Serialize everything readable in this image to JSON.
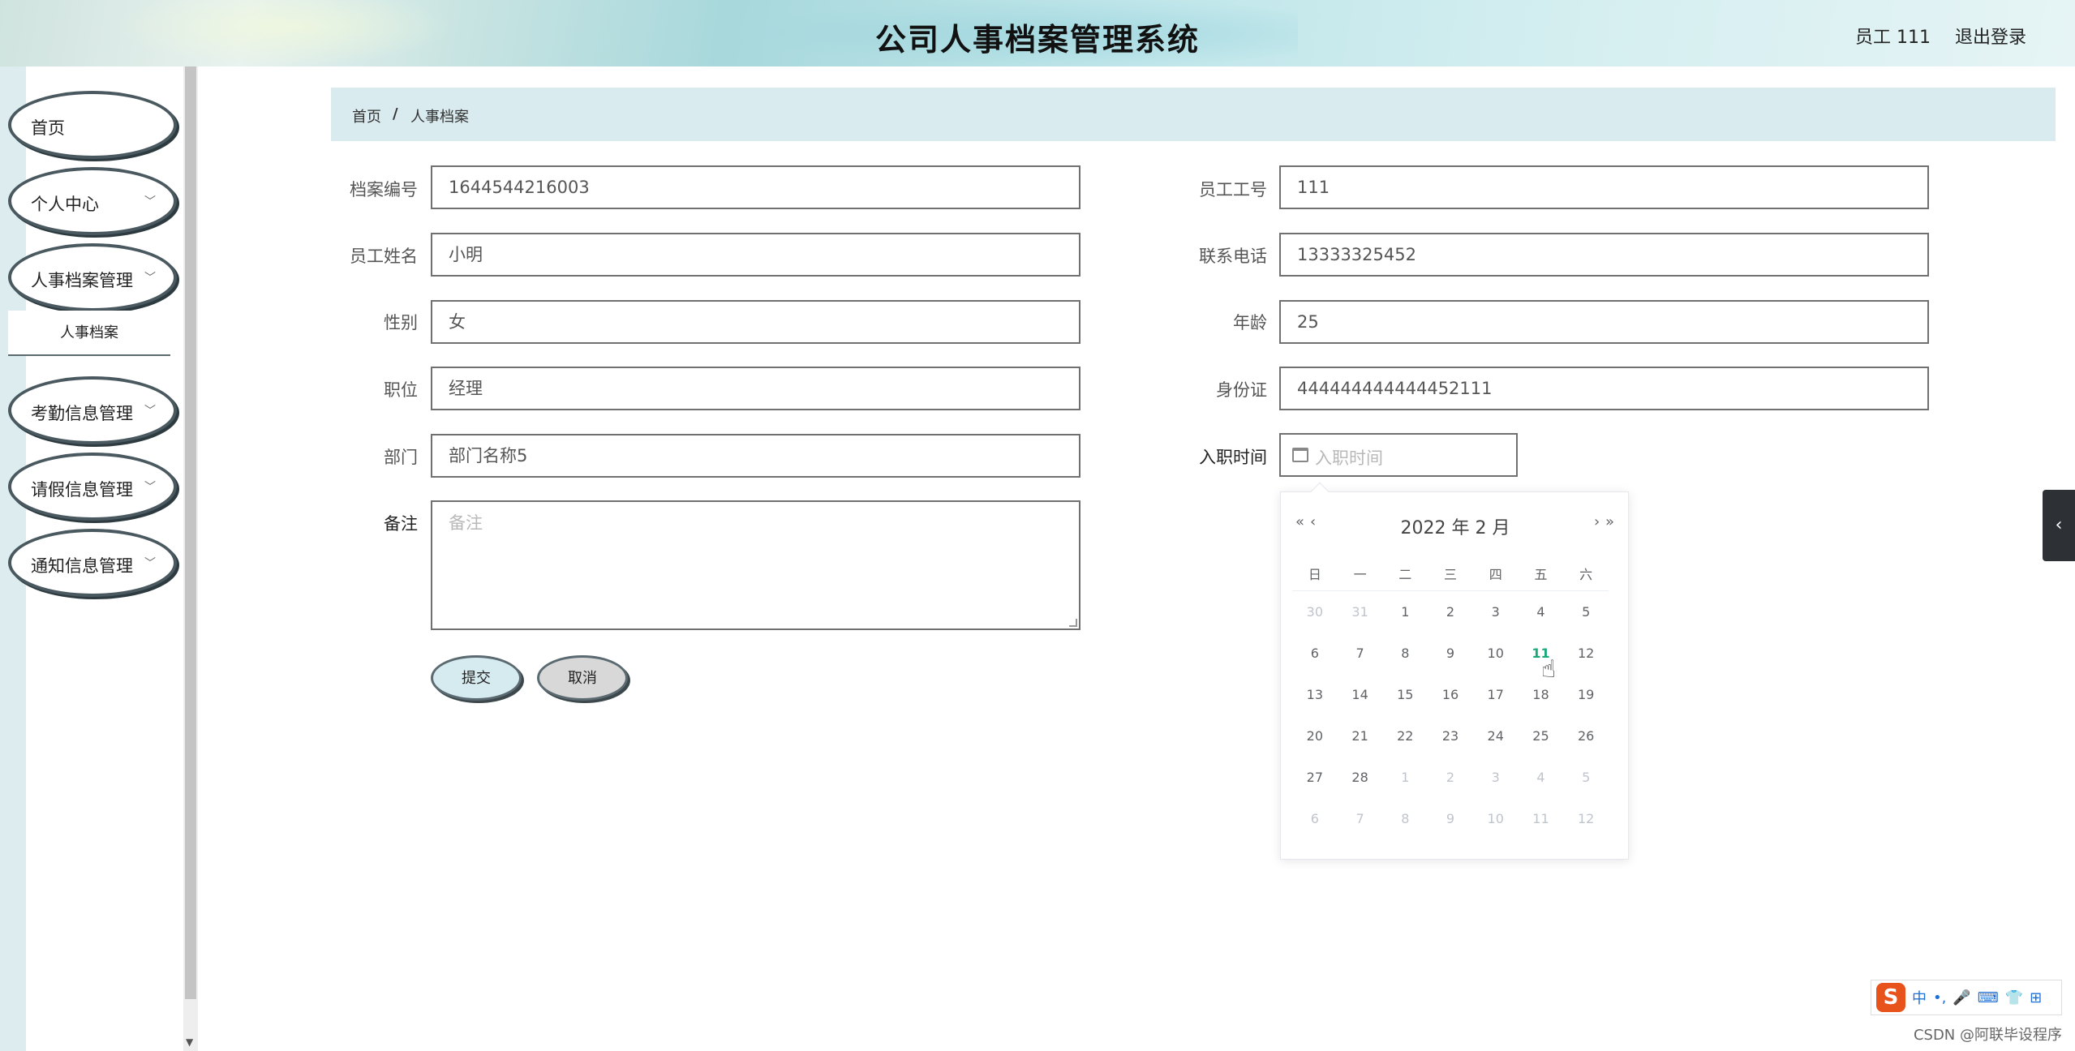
{
  "header": {
    "title": "公司人事档案管理系统",
    "user": "员工 111",
    "logout": "退出登录"
  },
  "sidebar": {
    "items": [
      {
        "label": "首页"
      },
      {
        "label": "个人中心"
      },
      {
        "label": "人事档案管理"
      },
      {
        "label": "考勤信息管理"
      },
      {
        "label": "请假信息管理"
      },
      {
        "label": "通知信息管理"
      }
    ],
    "submenu": {
      "label": "人事档案"
    },
    "chevron": "chevron-down-icon"
  },
  "breadcrumb": {
    "home": "首页",
    "separator": "/",
    "current": "人事档案"
  },
  "form": {
    "archive_no": {
      "label": "档案编号",
      "value": "1644544216003"
    },
    "employee_id": {
      "label": "员工工号",
      "value": "111"
    },
    "employee_name": {
      "label": "员工姓名",
      "value": "小明"
    },
    "phone": {
      "label": "联系电话",
      "value": "13333325452"
    },
    "gender": {
      "label": "性别",
      "value": "女"
    },
    "age": {
      "label": "年龄",
      "value": "25"
    },
    "position": {
      "label": "职位",
      "value": "经理"
    },
    "id_card": {
      "label": "身份证",
      "value": "444444444444452111"
    },
    "department": {
      "label": "部门",
      "value": "部门名称5"
    },
    "hire_date": {
      "label": "入职时间",
      "placeholder": "入职时间"
    },
    "remark": {
      "label": "备注",
      "placeholder": "备注"
    },
    "submit": "提交",
    "cancel": "取消"
  },
  "datepicker": {
    "prev_year": "«",
    "prev_month": "‹",
    "next_month": "›",
    "next_year": "»",
    "year_month": "2022 年  2 月",
    "weekdays": [
      "日",
      "一",
      "二",
      "三",
      "四",
      "五",
      "六"
    ],
    "rows": [
      [
        {
          "d": "30",
          "o": true
        },
        {
          "d": "31",
          "o": true
        },
        {
          "d": "1"
        },
        {
          "d": "2"
        },
        {
          "d": "3"
        },
        {
          "d": "4"
        },
        {
          "d": "5"
        }
      ],
      [
        {
          "d": "6"
        },
        {
          "d": "7"
        },
        {
          "d": "8"
        },
        {
          "d": "9"
        },
        {
          "d": "10"
        },
        {
          "d": "11",
          "t": true
        },
        {
          "d": "12"
        }
      ],
      [
        {
          "d": "13"
        },
        {
          "d": "14"
        },
        {
          "d": "15"
        },
        {
          "d": "16"
        },
        {
          "d": "17"
        },
        {
          "d": "18"
        },
        {
          "d": "19"
        }
      ],
      [
        {
          "d": "20"
        },
        {
          "d": "21"
        },
        {
          "d": "22"
        },
        {
          "d": "23"
        },
        {
          "d": "24"
        },
        {
          "d": "25"
        },
        {
          "d": "26"
        }
      ],
      [
        {
          "d": "27"
        },
        {
          "d": "28"
        },
        {
          "d": "1",
          "o": true
        },
        {
          "d": "2",
          "o": true
        },
        {
          "d": "3",
          "o": true
        },
        {
          "d": "4",
          "o": true
        },
        {
          "d": "5",
          "o": true
        }
      ],
      [
        {
          "d": "6",
          "o": true
        },
        {
          "d": "7",
          "o": true
        },
        {
          "d": "8",
          "o": true
        },
        {
          "d": "9",
          "o": true
        },
        {
          "d": "10",
          "o": true
        },
        {
          "d": "11",
          "o": true
        },
        {
          "d": "12",
          "o": true
        }
      ]
    ]
  },
  "ime": {
    "logo": "S",
    "items": [
      "中",
      "•,",
      "🎤",
      "⌨",
      "👕",
      "⊞"
    ]
  },
  "watermark": "CSDN @阿联毕设程序",
  "colors": {
    "breadcrumb_bg": "#d9ebee",
    "today": "#19a87a",
    "menu_border": "#4a5960"
  }
}
